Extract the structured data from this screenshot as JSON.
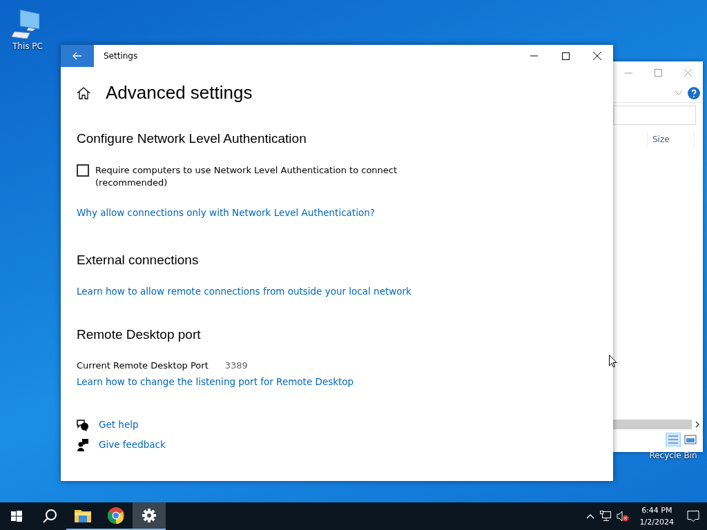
{
  "desktop_icons": [
    {
      "label": "This PC",
      "kind": "computer"
    },
    {
      "label": "Recycle Bin",
      "kind": "label-only"
    }
  ],
  "background_window": {
    "column_3": "Size"
  },
  "settings_window": {
    "title": "Settings",
    "page_title": "Advanced settings",
    "nla_section": {
      "heading": "Configure Network Level Authentication",
      "checkbox": {
        "label": "Require computers to use Network Level Authentication to connect (recommended)",
        "checked": false
      },
      "link": "Why allow connections only with Network Level Authentication?"
    },
    "external_section": {
      "heading": "External connections",
      "link": "Learn how to allow remote connections from outside your local network"
    },
    "port_section": {
      "heading": "Remote Desktop port",
      "label": "Current Remote Desktop Port",
      "value": "3389",
      "link": "Learn how to change the listening port for Remote Desktop"
    },
    "help_links": [
      {
        "kind": "help",
        "label": "Get help"
      },
      {
        "kind": "feedback",
        "label": "Give feedback"
      }
    ]
  },
  "taskbar": {
    "items": [
      {
        "kind": "start",
        "selected": false
      },
      {
        "kind": "search",
        "selected": false
      },
      {
        "kind": "explorer",
        "selected": false
      },
      {
        "kind": "browser",
        "selected": false
      },
      {
        "kind": "settings",
        "selected": true
      }
    ],
    "time": "6:44 PM",
    "date": "1/2/2024"
  }
}
